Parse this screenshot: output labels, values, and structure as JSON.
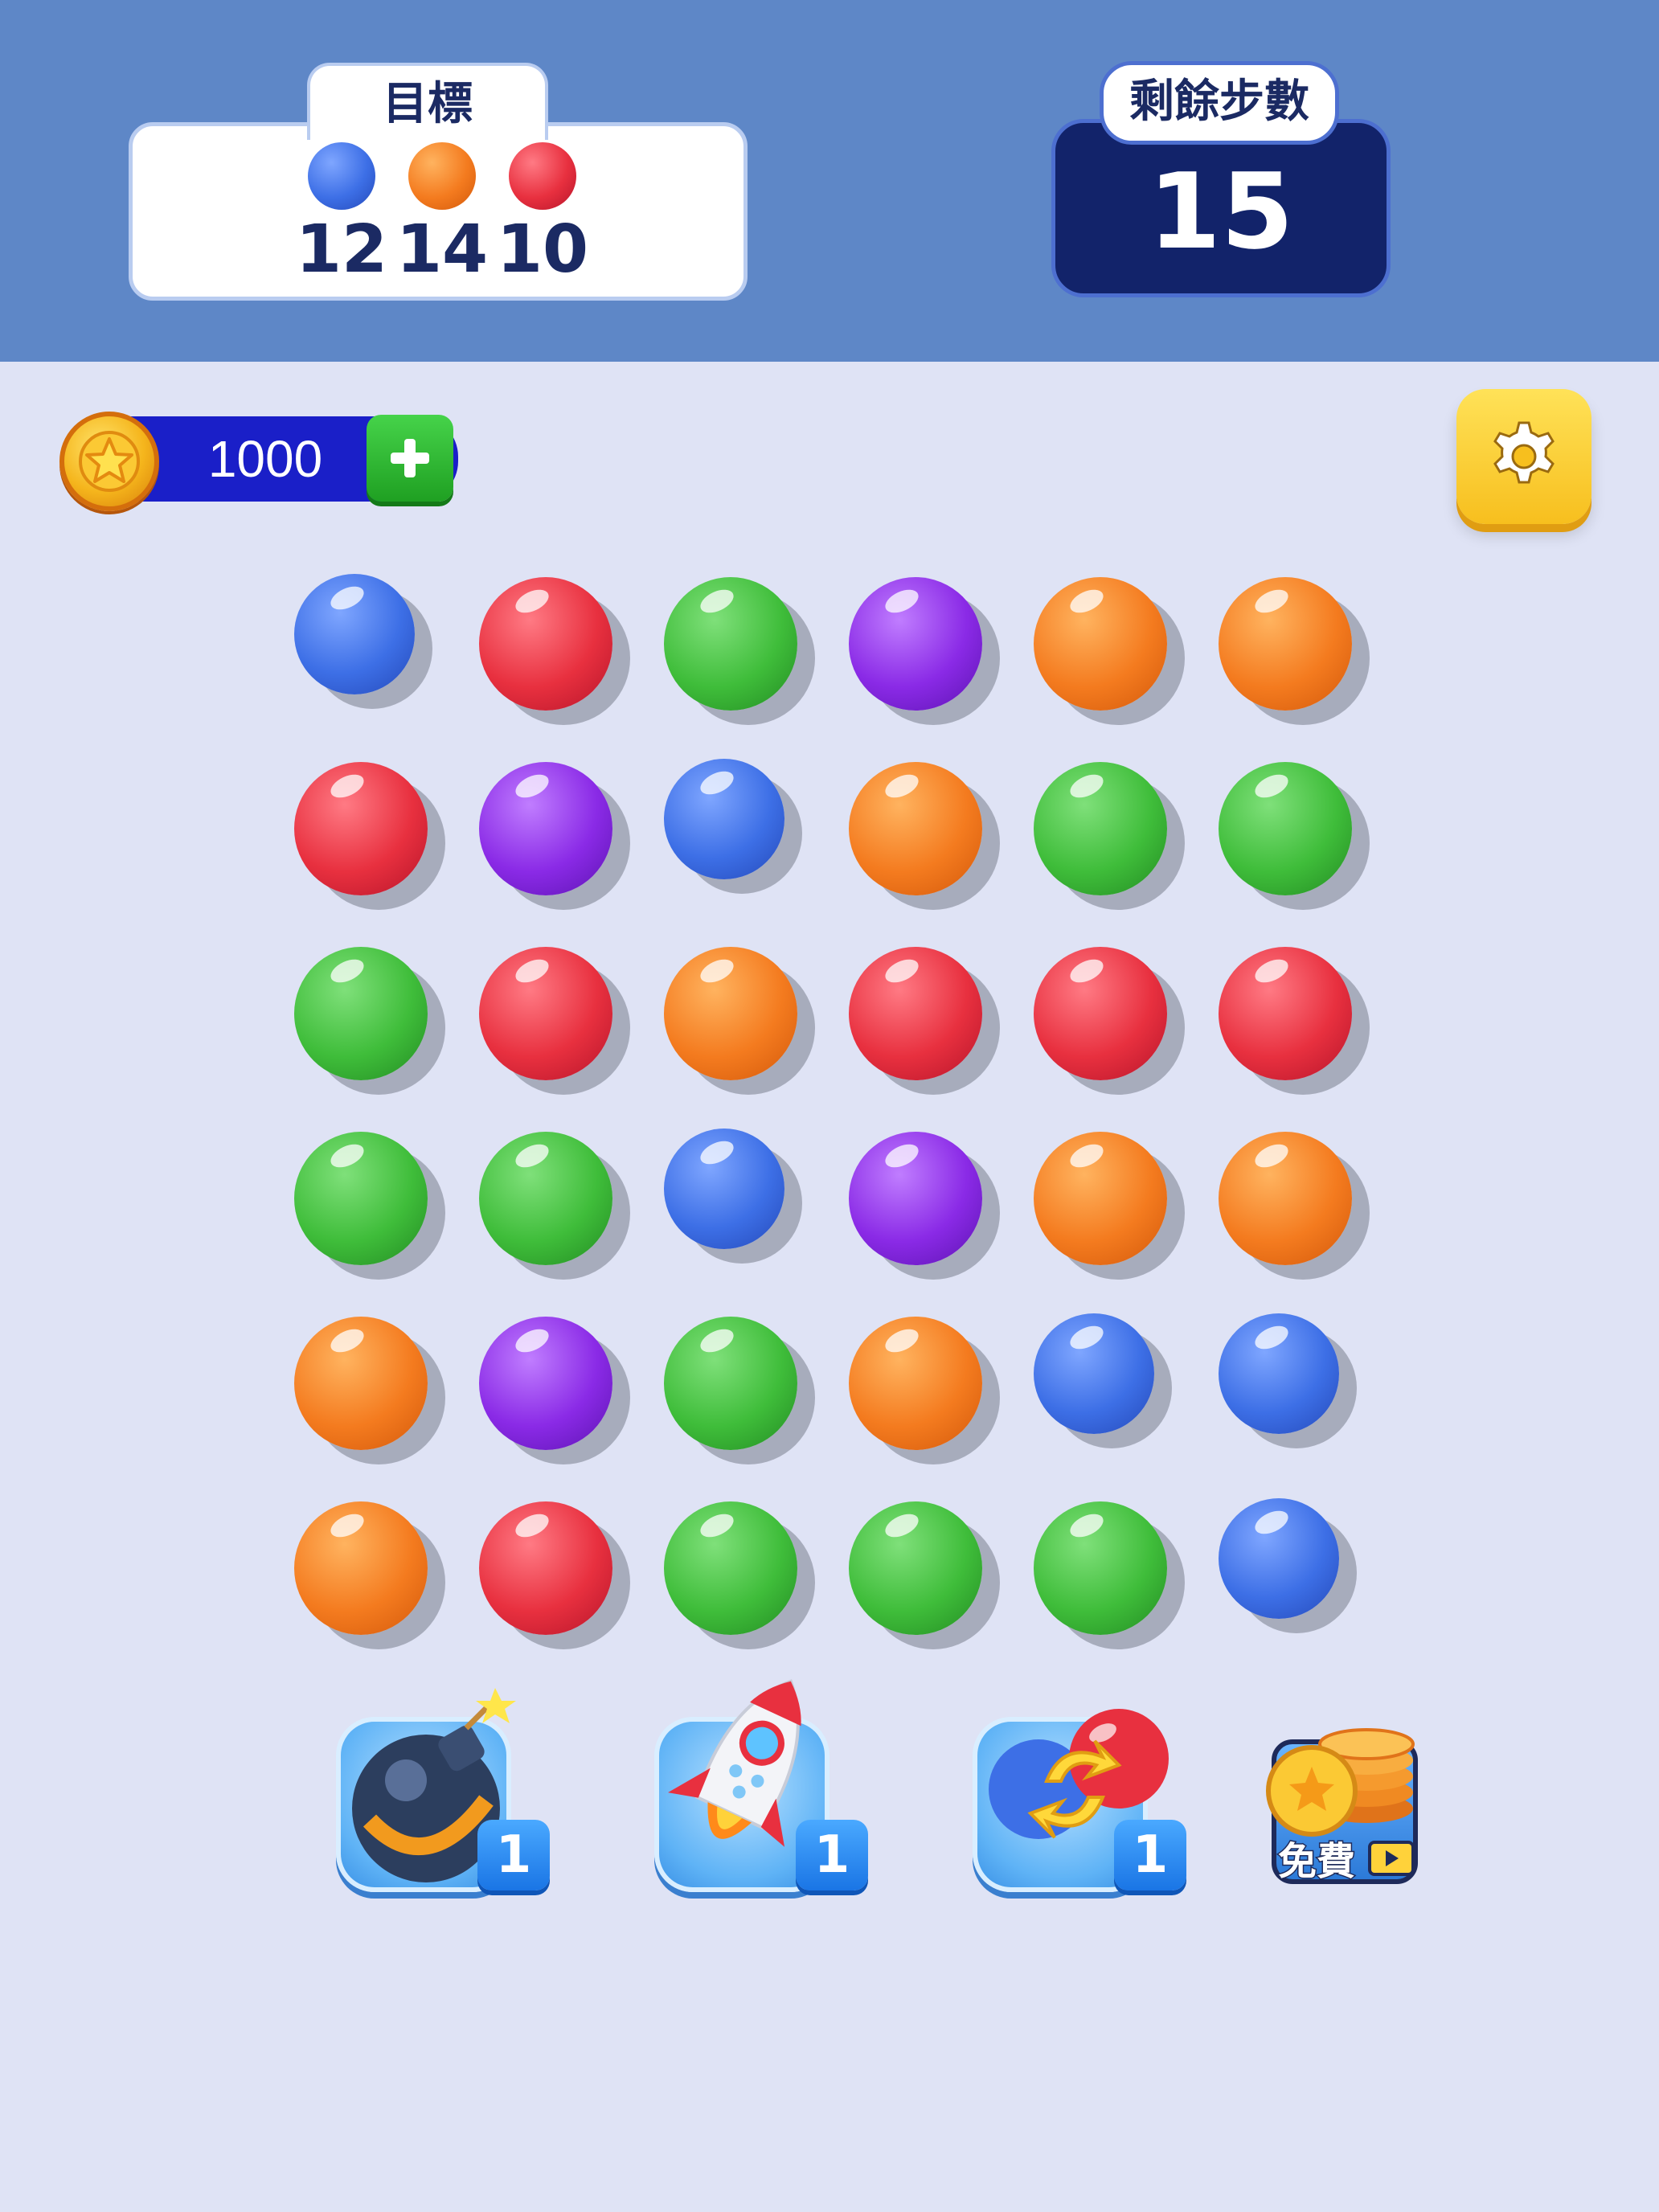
{
  "header": {
    "goal_title": "目標",
    "goals": [
      {
        "color": "blue",
        "count": "12"
      },
      {
        "color": "orange",
        "count": "14"
      },
      {
        "color": "red",
        "count": "10"
      }
    ],
    "moves_title": "剩餘步數",
    "moves_left": "15"
  },
  "currency": {
    "coins": "1000",
    "add_icon": "plus-icon",
    "coin_icon": "star-coin-icon"
  },
  "settings": {
    "icon": "gear-icon"
  },
  "colors": {
    "red": "#e8303f",
    "orange": "#f47b1f",
    "green": "#3fbd3a",
    "purple": "#8a2ae6",
    "blue": "#3d6fe6"
  },
  "board": {
    "rows": [
      [
        "blue",
        "red",
        "green",
        "purple",
        "orange",
        "orange"
      ],
      [
        "red",
        "purple",
        "blue",
        "orange",
        "green",
        "green"
      ],
      [
        "green",
        "red",
        "orange",
        "red",
        "red",
        "red"
      ],
      [
        "green",
        "green",
        "blue",
        "purple",
        "orange",
        "orange"
      ],
      [
        "orange",
        "purple",
        "green",
        "orange",
        "blue",
        "blue"
      ],
      [
        "orange",
        "red",
        "green",
        "green",
        "green",
        "blue"
      ]
    ]
  },
  "boosters": [
    {
      "name": "bomb",
      "icon": "bomb-icon",
      "count": "1"
    },
    {
      "name": "rocket",
      "icon": "rocket-icon",
      "count": "1"
    },
    {
      "name": "swap",
      "icon": "swap-icon",
      "count": "1"
    }
  ],
  "free_reward": {
    "label": "免費",
    "icon": "coin-stack-icon",
    "video_icon": "play-video-icon"
  }
}
